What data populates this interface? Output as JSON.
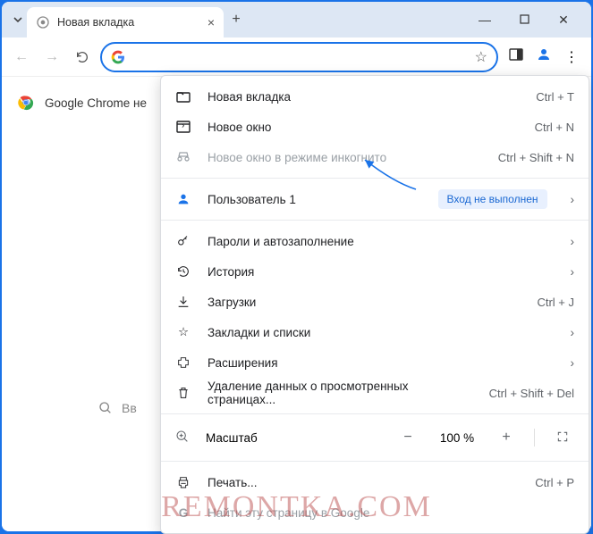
{
  "titlebar": {
    "tab_title": "Новая вкладка"
  },
  "toolbar": {
    "omnibox_value": ""
  },
  "page": {
    "truncated_text": "Google Chrome не",
    "search_hint": "Вв"
  },
  "menu": {
    "new_tab": {
      "label": "Новая вкладка",
      "accel": "Ctrl + T"
    },
    "new_window": {
      "label": "Новое окно",
      "accel": "Ctrl + N"
    },
    "incognito": {
      "label": "Новое окно в режиме инкогнито",
      "accel": "Ctrl + Shift + N"
    },
    "profile": {
      "label": "Пользователь 1",
      "badge": "Вход не выполнен"
    },
    "passwords": {
      "label": "Пароли и автозаполнение"
    },
    "history": {
      "label": "История"
    },
    "downloads": {
      "label": "Загрузки",
      "accel": "Ctrl + J"
    },
    "bookmarks": {
      "label": "Закладки и списки"
    },
    "extensions": {
      "label": "Расширения"
    },
    "clear_data": {
      "label": "Удаление данных о просмотренных страницах...",
      "accel": "Ctrl + Shift + Del"
    },
    "zoom": {
      "label": "Масштаб",
      "value": "100 %"
    },
    "print": {
      "label": "Печать...",
      "accel": "Ctrl + P"
    },
    "find_google": {
      "label": "Найти эту страницу в Google"
    }
  },
  "watermark": "REMONTKA.COM"
}
